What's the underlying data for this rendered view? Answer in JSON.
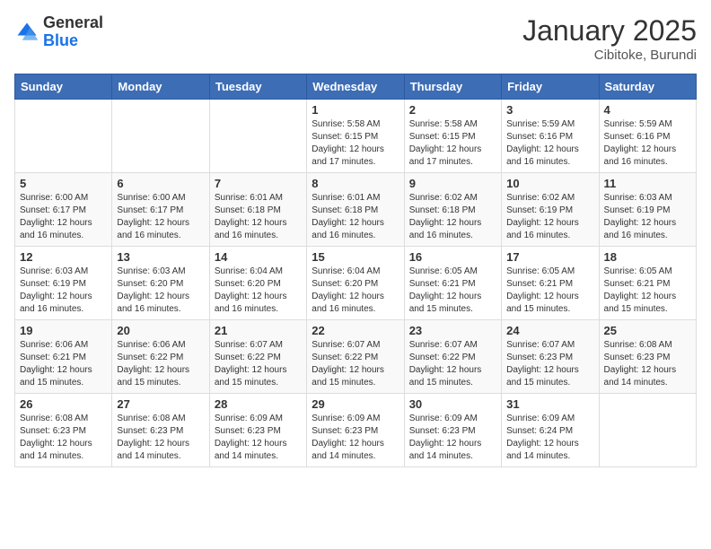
{
  "logo": {
    "general": "General",
    "blue": "Blue"
  },
  "title": "January 2025",
  "subtitle": "Cibitoke, Burundi",
  "weekdays": [
    "Sunday",
    "Monday",
    "Tuesday",
    "Wednesday",
    "Thursday",
    "Friday",
    "Saturday"
  ],
  "weeks": [
    [
      {
        "day": "",
        "info": ""
      },
      {
        "day": "",
        "info": ""
      },
      {
        "day": "",
        "info": ""
      },
      {
        "day": "1",
        "info": "Sunrise: 5:58 AM\nSunset: 6:15 PM\nDaylight: 12 hours and 17 minutes."
      },
      {
        "day": "2",
        "info": "Sunrise: 5:58 AM\nSunset: 6:15 PM\nDaylight: 12 hours and 17 minutes."
      },
      {
        "day": "3",
        "info": "Sunrise: 5:59 AM\nSunset: 6:16 PM\nDaylight: 12 hours and 16 minutes."
      },
      {
        "day": "4",
        "info": "Sunrise: 5:59 AM\nSunset: 6:16 PM\nDaylight: 12 hours and 16 minutes."
      }
    ],
    [
      {
        "day": "5",
        "info": "Sunrise: 6:00 AM\nSunset: 6:17 PM\nDaylight: 12 hours and 16 minutes."
      },
      {
        "day": "6",
        "info": "Sunrise: 6:00 AM\nSunset: 6:17 PM\nDaylight: 12 hours and 16 minutes."
      },
      {
        "day": "7",
        "info": "Sunrise: 6:01 AM\nSunset: 6:18 PM\nDaylight: 12 hours and 16 minutes."
      },
      {
        "day": "8",
        "info": "Sunrise: 6:01 AM\nSunset: 6:18 PM\nDaylight: 12 hours and 16 minutes."
      },
      {
        "day": "9",
        "info": "Sunrise: 6:02 AM\nSunset: 6:18 PM\nDaylight: 12 hours and 16 minutes."
      },
      {
        "day": "10",
        "info": "Sunrise: 6:02 AM\nSunset: 6:19 PM\nDaylight: 12 hours and 16 minutes."
      },
      {
        "day": "11",
        "info": "Sunrise: 6:03 AM\nSunset: 6:19 PM\nDaylight: 12 hours and 16 minutes."
      }
    ],
    [
      {
        "day": "12",
        "info": "Sunrise: 6:03 AM\nSunset: 6:19 PM\nDaylight: 12 hours and 16 minutes."
      },
      {
        "day": "13",
        "info": "Sunrise: 6:03 AM\nSunset: 6:20 PM\nDaylight: 12 hours and 16 minutes."
      },
      {
        "day": "14",
        "info": "Sunrise: 6:04 AM\nSunset: 6:20 PM\nDaylight: 12 hours and 16 minutes."
      },
      {
        "day": "15",
        "info": "Sunrise: 6:04 AM\nSunset: 6:20 PM\nDaylight: 12 hours and 16 minutes."
      },
      {
        "day": "16",
        "info": "Sunrise: 6:05 AM\nSunset: 6:21 PM\nDaylight: 12 hours and 15 minutes."
      },
      {
        "day": "17",
        "info": "Sunrise: 6:05 AM\nSunset: 6:21 PM\nDaylight: 12 hours and 15 minutes."
      },
      {
        "day": "18",
        "info": "Sunrise: 6:05 AM\nSunset: 6:21 PM\nDaylight: 12 hours and 15 minutes."
      }
    ],
    [
      {
        "day": "19",
        "info": "Sunrise: 6:06 AM\nSunset: 6:21 PM\nDaylight: 12 hours and 15 minutes."
      },
      {
        "day": "20",
        "info": "Sunrise: 6:06 AM\nSunset: 6:22 PM\nDaylight: 12 hours and 15 minutes."
      },
      {
        "day": "21",
        "info": "Sunrise: 6:07 AM\nSunset: 6:22 PM\nDaylight: 12 hours and 15 minutes."
      },
      {
        "day": "22",
        "info": "Sunrise: 6:07 AM\nSunset: 6:22 PM\nDaylight: 12 hours and 15 minutes."
      },
      {
        "day": "23",
        "info": "Sunrise: 6:07 AM\nSunset: 6:22 PM\nDaylight: 12 hours and 15 minutes."
      },
      {
        "day": "24",
        "info": "Sunrise: 6:07 AM\nSunset: 6:23 PM\nDaylight: 12 hours and 15 minutes."
      },
      {
        "day": "25",
        "info": "Sunrise: 6:08 AM\nSunset: 6:23 PM\nDaylight: 12 hours and 14 minutes."
      }
    ],
    [
      {
        "day": "26",
        "info": "Sunrise: 6:08 AM\nSunset: 6:23 PM\nDaylight: 12 hours and 14 minutes."
      },
      {
        "day": "27",
        "info": "Sunrise: 6:08 AM\nSunset: 6:23 PM\nDaylight: 12 hours and 14 minutes."
      },
      {
        "day": "28",
        "info": "Sunrise: 6:09 AM\nSunset: 6:23 PM\nDaylight: 12 hours and 14 minutes."
      },
      {
        "day": "29",
        "info": "Sunrise: 6:09 AM\nSunset: 6:23 PM\nDaylight: 12 hours and 14 minutes."
      },
      {
        "day": "30",
        "info": "Sunrise: 6:09 AM\nSunset: 6:23 PM\nDaylight: 12 hours and 14 minutes."
      },
      {
        "day": "31",
        "info": "Sunrise: 6:09 AM\nSunset: 6:24 PM\nDaylight: 12 hours and 14 minutes."
      },
      {
        "day": "",
        "info": ""
      }
    ]
  ]
}
